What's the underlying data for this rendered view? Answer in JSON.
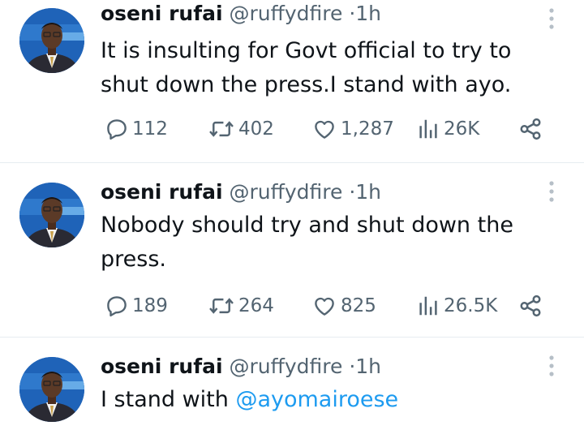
{
  "colors": {
    "text": "#0f1419",
    "secondary": "#536471",
    "link": "#1d9bf0",
    "divider": "#e6ecf0"
  },
  "icons": {
    "reply": "speech-bubble-icon",
    "retweet": "retweet-arrows-icon",
    "like": "heart-icon",
    "views": "bar-chart-icon",
    "share": "share-nodes-icon",
    "more": "vertical-dots-icon"
  },
  "tweets": [
    {
      "author_name": "oseni rufai",
      "handle": "@ruffydfire",
      "separator": "·",
      "time": "1h",
      "text": "It is insulting for Govt official to try to shut down the press.I stand with ayo.",
      "replies": "112",
      "retweets": "402",
      "likes": "1,287",
      "views": "26K"
    },
    {
      "author_name": "oseni rufai",
      "handle": "@ruffydfire",
      "separator": "·",
      "time": "1h",
      "text": "Nobody should try and shut down the press.",
      "replies": "189",
      "retweets": "264",
      "likes": "825",
      "views": "26.5K"
    },
    {
      "author_name": "oseni rufai",
      "handle": "@ruffydfire",
      "separator": "·",
      "time": "1h",
      "text_prefix": "I stand with ",
      "mention": "@ayomairoese"
    }
  ]
}
